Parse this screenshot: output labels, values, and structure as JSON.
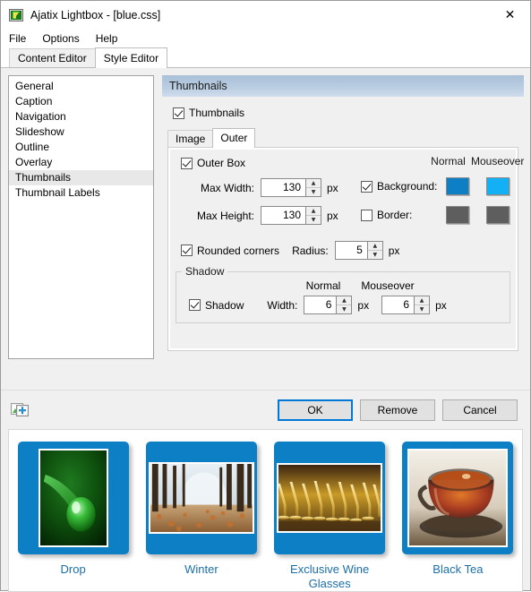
{
  "window": {
    "title": "Ajatix Lightbox - [blue.css]",
    "icon": "app-lightbox-icon",
    "close_label": "✕"
  },
  "menu": {
    "items": [
      {
        "label": "File"
      },
      {
        "label": "Options"
      },
      {
        "label": "Help"
      }
    ]
  },
  "main_tabs": [
    {
      "label": "Content Editor",
      "active": false
    },
    {
      "label": "Style Editor",
      "active": true
    }
  ],
  "sidebar": {
    "items": [
      {
        "label": "General",
        "selected": false
      },
      {
        "label": "Caption",
        "selected": false
      },
      {
        "label": "Navigation",
        "selected": false
      },
      {
        "label": "Slideshow",
        "selected": false
      },
      {
        "label": "Outline",
        "selected": false
      },
      {
        "label": "Overlay",
        "selected": false
      },
      {
        "label": "Thumbnails",
        "selected": true
      },
      {
        "label": "Thumbnail Labels",
        "selected": false
      }
    ]
  },
  "panel": {
    "header_title": "Thumbnails",
    "enable_checkbox": {
      "label": "Thumbnails",
      "checked": true
    },
    "tabs": [
      {
        "label": "Image",
        "active": false
      },
      {
        "label": "Outer",
        "active": true
      }
    ],
    "outer": {
      "outer_box": {
        "label": "Outer Box",
        "checked": true
      },
      "max_width": {
        "label": "Max Width:",
        "value": "130",
        "unit": "px"
      },
      "max_height": {
        "label": "Max Height:",
        "value": "130",
        "unit": "px"
      },
      "columns": {
        "normal": "Normal",
        "mouseover": "Mouseover"
      },
      "background": {
        "label": "Background:",
        "checked": true,
        "normal_color": "#0d7fc4",
        "mouseover_color": "#14b0f5"
      },
      "border": {
        "label": "Border:",
        "checked": false,
        "normal_color": "#5e5e5e",
        "mouseover_color": "#5e5e5e"
      },
      "rounded_corners": {
        "label": "Rounded corners",
        "checked": true
      },
      "radius": {
        "label": "Radius:",
        "value": "5",
        "unit": "px"
      },
      "shadow_group": {
        "title": "Shadow",
        "checkbox": {
          "label": "Shadow",
          "checked": true
        },
        "columns": {
          "normal": "Normal",
          "mouseover": "Mouseover"
        },
        "width_label": "Width:",
        "normal_width": {
          "value": "6",
          "unit": "px"
        },
        "mouseover_width": {
          "value": "6",
          "unit": "px"
        }
      }
    }
  },
  "buttonbar": {
    "add_icon": "add-image-icon",
    "buttons": [
      {
        "label": "OK",
        "primary": true
      },
      {
        "label": "Remove",
        "primary": false
      },
      {
        "label": "Cancel",
        "primary": false
      }
    ]
  },
  "gallery": {
    "items": [
      {
        "label": "Drop",
        "orientation": "portrait",
        "art": "drop"
      },
      {
        "label": "Winter",
        "orientation": "landscape",
        "art": "winter"
      },
      {
        "label": "Exclusive Wine Glasses",
        "orientation": "landscape",
        "art": "wine"
      },
      {
        "label": "Black Tea",
        "orientation": "square",
        "art": "tea"
      }
    ],
    "box_color": "#0d7fc4",
    "label_color": "#1b6fa8"
  }
}
